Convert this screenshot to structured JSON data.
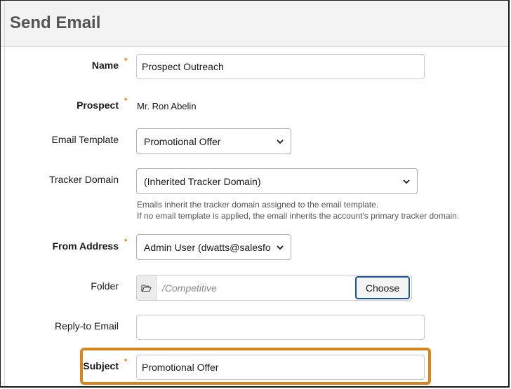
{
  "page": {
    "title": "Send Email"
  },
  "form": {
    "name": {
      "label": "Name",
      "required": "*",
      "value": "Prospect Outreach"
    },
    "prospect": {
      "label": "Prospect",
      "required": "*",
      "value": "Mr. Ron Abelin"
    },
    "email_template": {
      "label": "Email Template",
      "selected": "Promotional Offer"
    },
    "tracker_domain": {
      "label": "Tracker Domain",
      "selected": "(Inherited Tracker Domain)",
      "help_line1": "Emails inherit the tracker domain assigned to the email template.",
      "help_line2": "If no email template is applied, the email inherits the account's primary tracker domain."
    },
    "from_address": {
      "label": "From Address",
      "required": "*",
      "selected": "Admin User (dwatts@salesfo"
    },
    "folder": {
      "label": "Folder",
      "path": "/Competitive",
      "choose_label": "Choose"
    },
    "reply_to": {
      "label": "Reply-to Email",
      "value": ""
    },
    "subject": {
      "label": "Subject",
      "required": "*",
      "value": "Promotional Offer"
    }
  },
  "colors": {
    "required_marker": "#e07b00",
    "highlight": "#d7851f",
    "button_border": "#1b5297"
  },
  "icons": {
    "select_arrow": "chevron-down-icon",
    "folder": "folder-open-icon"
  }
}
